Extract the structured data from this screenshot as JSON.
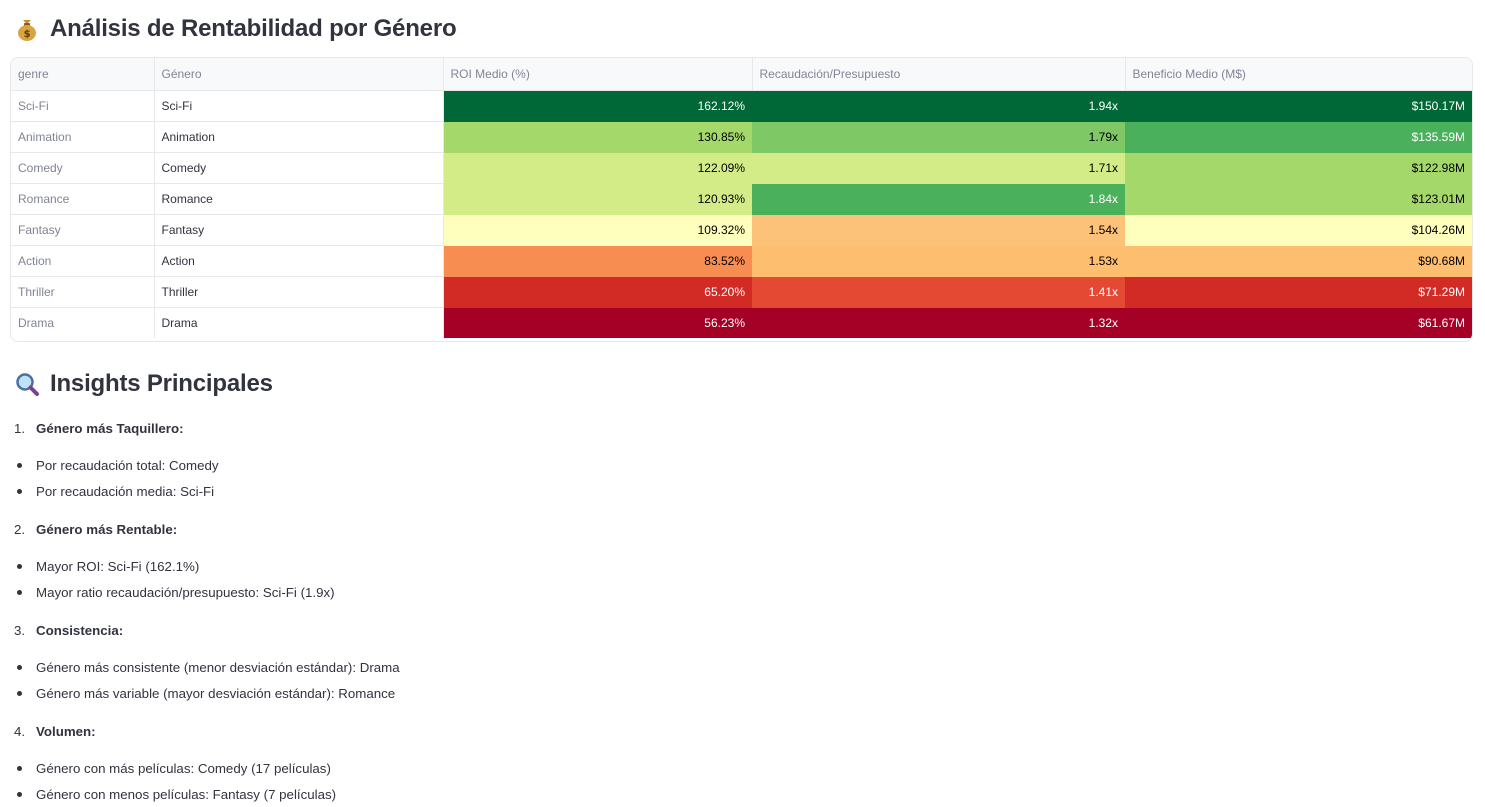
{
  "title": "Análisis de Rentabilidad por Género",
  "title_icon": "money-bag-icon",
  "table": {
    "headers": [
      "genre",
      "Género",
      "ROI Medio (%)",
      "Recaudación/Presupuesto",
      "Beneficio Medio (M$)"
    ],
    "rows": [
      {
        "idx": "Sci-Fi",
        "genero": "Sci-Fi",
        "roi": "162.12%",
        "ratio": "1.94x",
        "beneficio": "$150.17M",
        "colors": {
          "roi": "#006837",
          "ratio": "#006837",
          "beneficio": "#006837"
        }
      },
      {
        "idx": "Animation",
        "genero": "Animation",
        "roi": "130.85%",
        "ratio": "1.79x",
        "beneficio": "$135.59M",
        "colors": {
          "roi": "#a5d86a",
          "ratio": "#7fc866",
          "beneficio": "#4bb05c"
        }
      },
      {
        "idx": "Comedy",
        "genero": "Comedy",
        "roi": "122.09%",
        "ratio": "1.71x",
        "beneficio": "$122.98M",
        "colors": {
          "roi": "#d3ec87",
          "ratio": "#d3ec87",
          "beneficio": "#a5d86a"
        }
      },
      {
        "idx": "Romance",
        "genero": "Romance",
        "roi": "120.93%",
        "ratio": "1.84x",
        "beneficio": "$123.01M",
        "colors": {
          "roi": "#d3ec87",
          "ratio": "#4bb05c",
          "beneficio": "#a5d86a"
        }
      },
      {
        "idx": "Fantasy",
        "genero": "Fantasy",
        "roi": "109.32%",
        "ratio": "1.54x",
        "beneficio": "$104.26M",
        "colors": {
          "roi": "#fefebd",
          "ratio": "#fdc27a",
          "beneficio": "#fefebd"
        }
      },
      {
        "idx": "Action",
        "genero": "Action",
        "roi": "83.52%",
        "ratio": "1.53x",
        "beneficio": "$90.68M",
        "colors": {
          "roi": "#f88d52",
          "ratio": "#fdbf6f",
          "beneficio": "#fdbf6f"
        }
      },
      {
        "idx": "Thriller",
        "genero": "Thriller",
        "roi": "65.20%",
        "ratio": "1.41x",
        "beneficio": "$71.29M",
        "colors": {
          "roi": "#d22b26",
          "ratio": "#e34933",
          "beneficio": "#d22b26"
        }
      },
      {
        "idx": "Drama",
        "genero": "Drama",
        "roi": "56.23%",
        "ratio": "1.32x",
        "beneficio": "$61.67M",
        "colors": {
          "roi": "#a50026",
          "ratio": "#a50026",
          "beneficio": "#a50026"
        }
      }
    ]
  },
  "insights": {
    "title": "Insights Principales",
    "title_icon": "magnifying-glass-icon",
    "sections": [
      {
        "number": "1.",
        "title": "Género más Taquillero:",
        "items": [
          "Por recaudación total: Comedy",
          "Por recaudación media: Sci-Fi"
        ]
      },
      {
        "number": "2.",
        "title": "Género más Rentable:",
        "items": [
          "Mayor ROI: Sci-Fi (162.1%)",
          "Mayor ratio recaudación/presupuesto: Sci-Fi (1.9x)"
        ]
      },
      {
        "number": "3.",
        "title": "Consistencia:",
        "items": [
          "Género más consistente (menor desviación estándar): Drama",
          "Género más variable (mayor desviación estándar): Romance"
        ]
      },
      {
        "number": "4.",
        "title": "Volumen:",
        "items": [
          "Género con más películas: Comedy (17 películas)",
          "Género con menos películas: Fantasy (7 películas)"
        ]
      }
    ]
  }
}
